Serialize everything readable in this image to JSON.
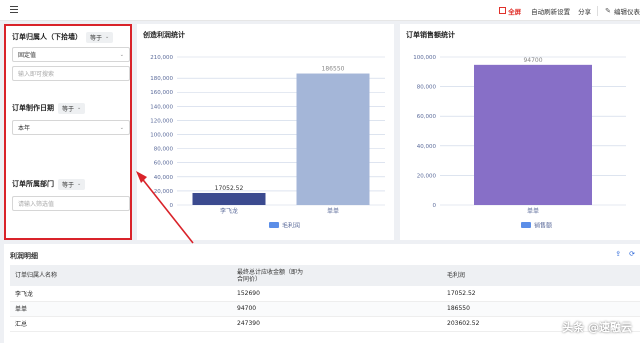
{
  "toolbar": {
    "fullscreen_label": "全屏",
    "auto_refresh_label": "自动刷新设置",
    "share_label": "分享",
    "edit_label": "编辑仪表"
  },
  "filters": [
    {
      "title": "订单归属人（下拾墙）",
      "operator": "等于",
      "value": "固定值",
      "placeholder": "输入即可搜索"
    },
    {
      "title": "订单制作日期",
      "operator": "等于",
      "value": "本年"
    },
    {
      "title": "订单所属部门",
      "operator": "等于",
      "placeholder": "请输入筛选值"
    }
  ],
  "chart_data": [
    {
      "type": "bar",
      "title": "创造利润统计",
      "categories": [
        "李飞龙",
        "单单"
      ],
      "values": [
        17052.52,
        186550
      ],
      "data_labels": [
        "17052.52",
        "186550"
      ],
      "bar_colors": [
        "#3b4a8f",
        "#a4b6d8"
      ],
      "ylim": [
        0,
        210000
      ],
      "yticks": [
        "0",
        "20,000",
        "40,000",
        "60,000",
        "80,000",
        "100,000",
        "120,000",
        "140,000",
        "160,000",
        "180,000",
        "210,000"
      ],
      "ytick_values": [
        0,
        20000,
        40000,
        60000,
        80000,
        100000,
        120000,
        140000,
        160000,
        180000,
        210000
      ],
      "legend": [
        {
          "name": "毛利润",
          "color": "#5b8ee8"
        }
      ]
    },
    {
      "type": "bar",
      "title": "订单销售额统计",
      "categories": [
        "单单"
      ],
      "values": [
        94700
      ],
      "data_labels": [
        "94700"
      ],
      "bar_colors": [
        "#876fc7"
      ],
      "ylim": [
        0,
        100000
      ],
      "yticks": [
        "0",
        "20,000",
        "40,000",
        "60,000",
        "80,000",
        "100,000"
      ],
      "ytick_values": [
        0,
        20000,
        40000,
        60000,
        80000,
        100000
      ],
      "legend": [
        {
          "name": "销售额",
          "color": "#5b8ee8"
        }
      ]
    }
  ],
  "table": {
    "title": "利润明细",
    "columns": [
      "订单归属人名称",
      "最终总计应收金额（即为\n合同价）",
      "毛利润"
    ],
    "rows": [
      [
        "李飞龙",
        "152690",
        "17052.52"
      ],
      [
        "单单",
        "94700",
        "186550"
      ],
      [
        "汇总",
        "247390",
        "203602.52"
      ]
    ]
  },
  "watermark": "头条 @速融云",
  "colors": {
    "highlight": "#d9232a",
    "accent": "#2a66d8"
  }
}
